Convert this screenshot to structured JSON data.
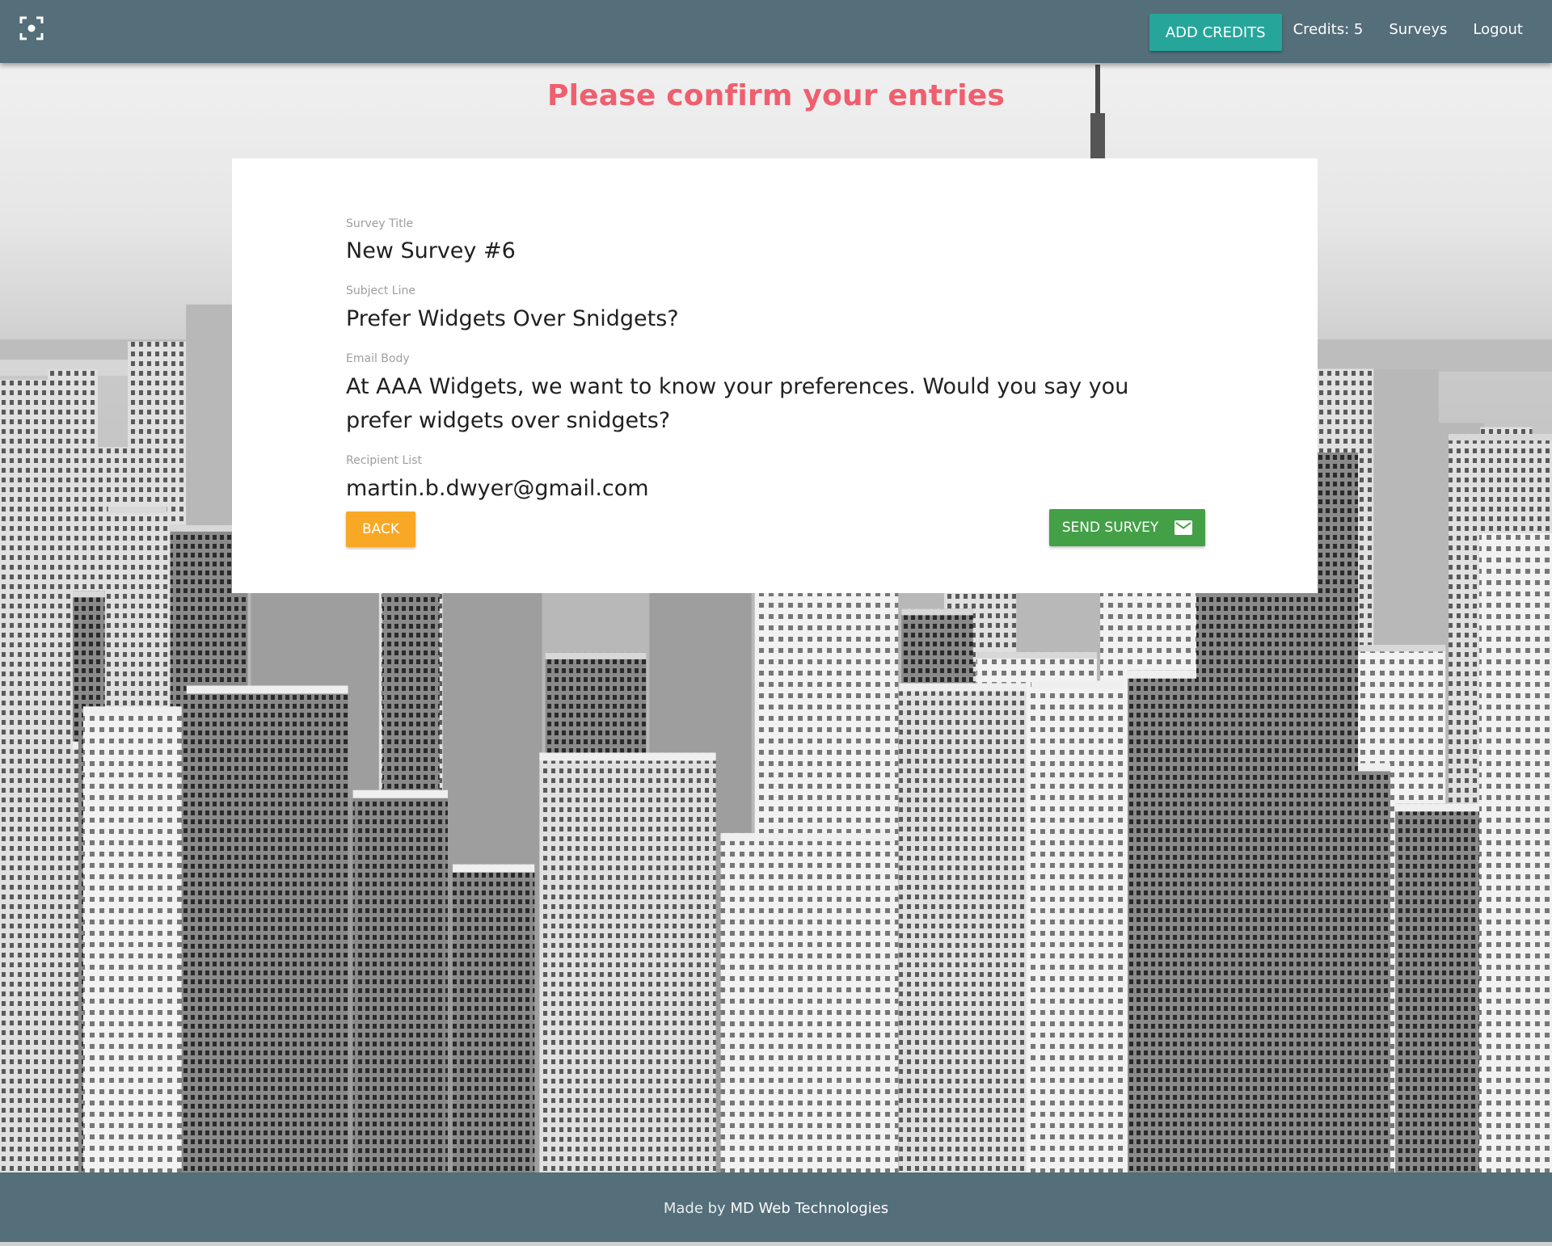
{
  "navbar": {
    "logo_icon": "focus-frame-icon",
    "add_credits_label": "ADD CREDITS",
    "credits_label": "Credits: 5",
    "surveys_label": "Surveys",
    "logout_label": "Logout"
  },
  "page": {
    "title": "Please confirm your entries"
  },
  "review": {
    "fields": [
      {
        "label": "Survey Title",
        "value": "New Survey #6"
      },
      {
        "label": "Subject Line",
        "value": "Prefer Widgets Over Snidgets?"
      },
      {
        "label": "Email Body",
        "value": "At AAA Widgets, we want to know your preferences. Would you say you prefer widgets over snidgets?"
      },
      {
        "label": "Recipient List",
        "value": "martin.b.dwyer@gmail.com"
      }
    ],
    "back_label": "BACK",
    "send_label": "SEND SURVEY",
    "send_icon": "email-icon"
  },
  "footer": {
    "prefix": "Made by ",
    "link_text": "MD Web Technologies"
  },
  "colors": {
    "navbar": "#546e7a",
    "accent_teal": "#26a69a",
    "title_red": "#ef5f6e",
    "back_amber": "#f9a825",
    "send_green": "#43a047"
  }
}
